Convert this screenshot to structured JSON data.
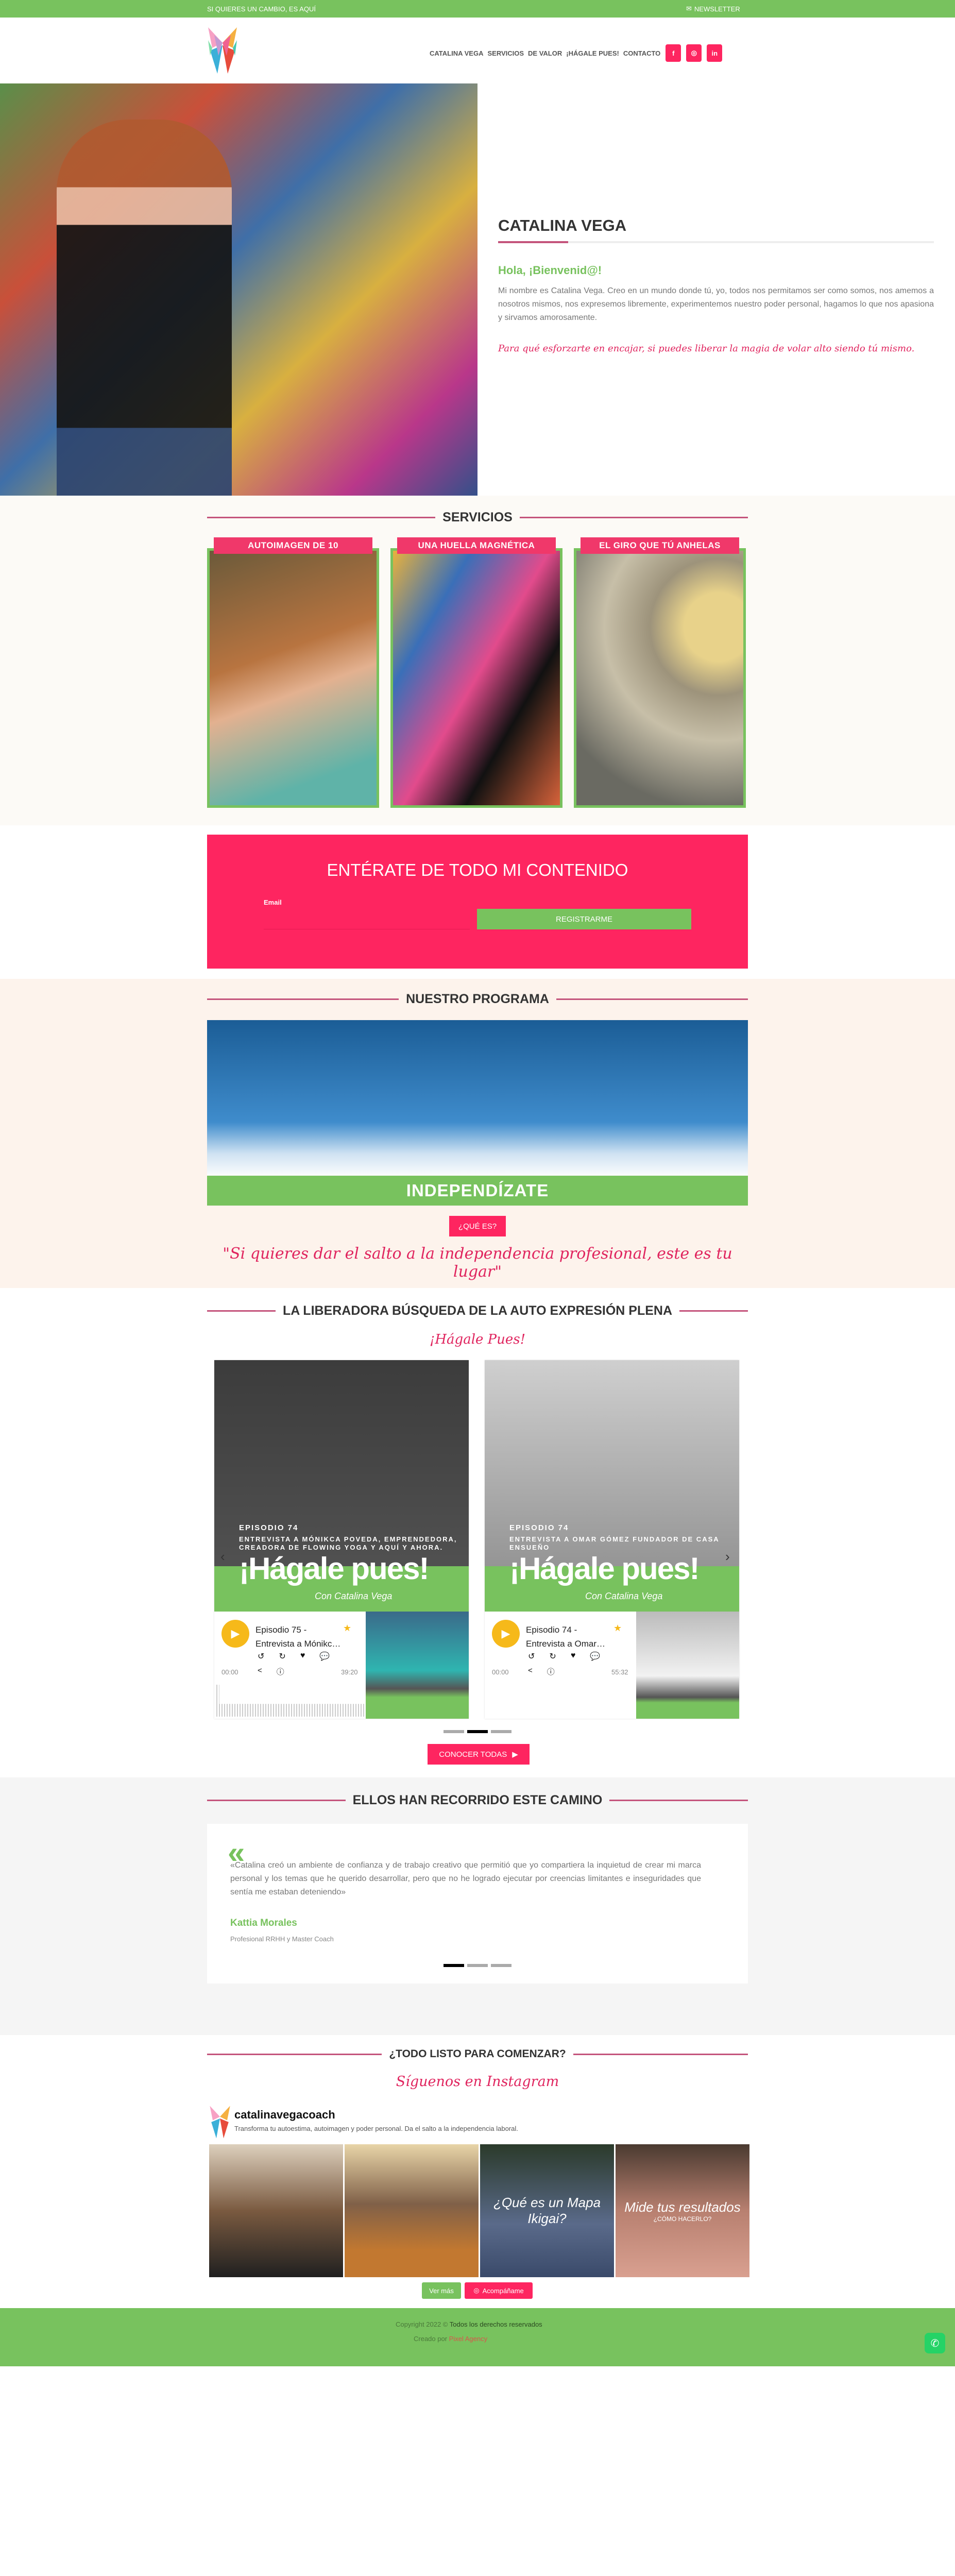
{
  "topbar": {
    "tagline": "SI QUIERES UN CAMBIO, ES AQUÍ",
    "newsletter": "NEWSLETTER",
    "newsletter_icon": "envelope-icon"
  },
  "nav": {
    "items": [
      "CATALINA VEGA",
      "SERVICIOS",
      "DE VALOR",
      "¡HÁGALE PUES!",
      "CONTACTO"
    ],
    "social": [
      "f",
      "◎",
      "in"
    ],
    "social_icons": [
      "facebook-icon",
      "instagram-icon",
      "linkedin-icon"
    ]
  },
  "hero": {
    "title": "CATALINA VEGA",
    "greeting": "Hola, ¡Bienvenid@!",
    "paragraph": "Mi nombre es Catalina Vega. Creo en un mundo donde tú, yo, todos nos permitamos ser como somos, nos amemos a nosotros mismos, nos expresemos libremente, experimentemos nuestro poder personal, hagamos lo que nos apasiona y sirvamos amorosamente.",
    "slogan": "Para qué esforzarte en encajar, si puedes liberar la magia de volar alto siendo tú mismo."
  },
  "services": {
    "title": "SERVICIOS",
    "cards": [
      {
        "label": "AUTOIMAGEN DE 10"
      },
      {
        "label": "UNA HUELLA MAGNÉTICA"
      },
      {
        "label": "EL GIRO QUE TÚ ANHELAS"
      }
    ]
  },
  "newsletter": {
    "title": "ENTÉRATE DE TODO MI CONTENIDO",
    "email_label": "Email",
    "email_value": "",
    "button": "REGISTRARME"
  },
  "program": {
    "title": "NUESTRO PROGRAMA",
    "banner": "INDEPENDÍZATE",
    "button": "¿QUÉ ES?",
    "quote": "\"Si quieres dar el salto a la independencia profesional, este es tu lugar\""
  },
  "podcast": {
    "title": "LA LIBERADORA BÚSQUEDA DE LA AUTO EXPRESIÓN PLENA",
    "subtitle": "¡Hágale Pues!",
    "episodes": [
      {
        "cover_episode": "EPISODIO 74",
        "cover_desc": "ENTREVISTA A MÓNIKCA POVEDA, EMPRENDEDORA, CREADORA DE FLOWING YOGA Y AQUÍ Y AHORA.",
        "cover_brand": "¡Hágale pues!",
        "cover_host": "Con Catalina Vega",
        "title_line1": "Episodio 75 -",
        "title_line2": "Entrevista a Mónikc…",
        "start": "00:00",
        "duration": "39:20"
      },
      {
        "cover_episode": "EPISODIO 74",
        "cover_desc": "ENTREVISTA A OMAR GÓMEZ FUNDADOR DE CASA ENSUEÑO",
        "cover_brand": "¡Hágale pues!",
        "cover_host": "Con Catalina Vega",
        "title_line1": "Episodio 74 -",
        "title_line2": "Entrevista a Omar…",
        "start": "00:00",
        "duration": "55:32"
      }
    ],
    "slider_active": 2,
    "slider_count": 3,
    "button": "CONOCER TODAS"
  },
  "testimonials": {
    "title": "ELLOS HAN RECORRIDO ESTE CAMINO",
    "quote": "«Catalina creó un ambiente de confianza y de trabajo creativo que permitió que yo compartiera la inquietud de crear mi marca personal y los temas que he querido desarrollar, pero que no he logrado ejecutar por creencias limitantes e inseguridades que sentía me estaban deteniendo»",
    "name": "Kattia Morales",
    "role": "Profesional RRHH y Master Coach",
    "slider_active": 1,
    "slider_count": 3
  },
  "instagram": {
    "title": "¿TODO LISTO PARA COMENZAR?",
    "subtitle": "Síguenos en Instagram",
    "username": "catalinavegacoach",
    "bio": "Transforma tu autoestima, autoimagen y poder personal. Da el salto a la independencia laboral.",
    "posts": [
      {
        "text": ""
      },
      {
        "text": ""
      },
      {
        "text": "¿Qué es un Mapa Ikigai?"
      },
      {
        "text": "Mide tus resultados",
        "sub": "¿CÓMO HACERLO?"
      }
    ],
    "more_button": "Ver más",
    "follow_button": "Acompáñame"
  },
  "footer": {
    "copyright": "Copyright 2022 ©",
    "rights": "Todos los derechos reservados",
    "created_by": "Creado por",
    "agency": "Pixel Agency"
  },
  "colors": {
    "green": "#78c25e",
    "pink": "#fe2560",
    "accent_line": "#c4547c"
  }
}
